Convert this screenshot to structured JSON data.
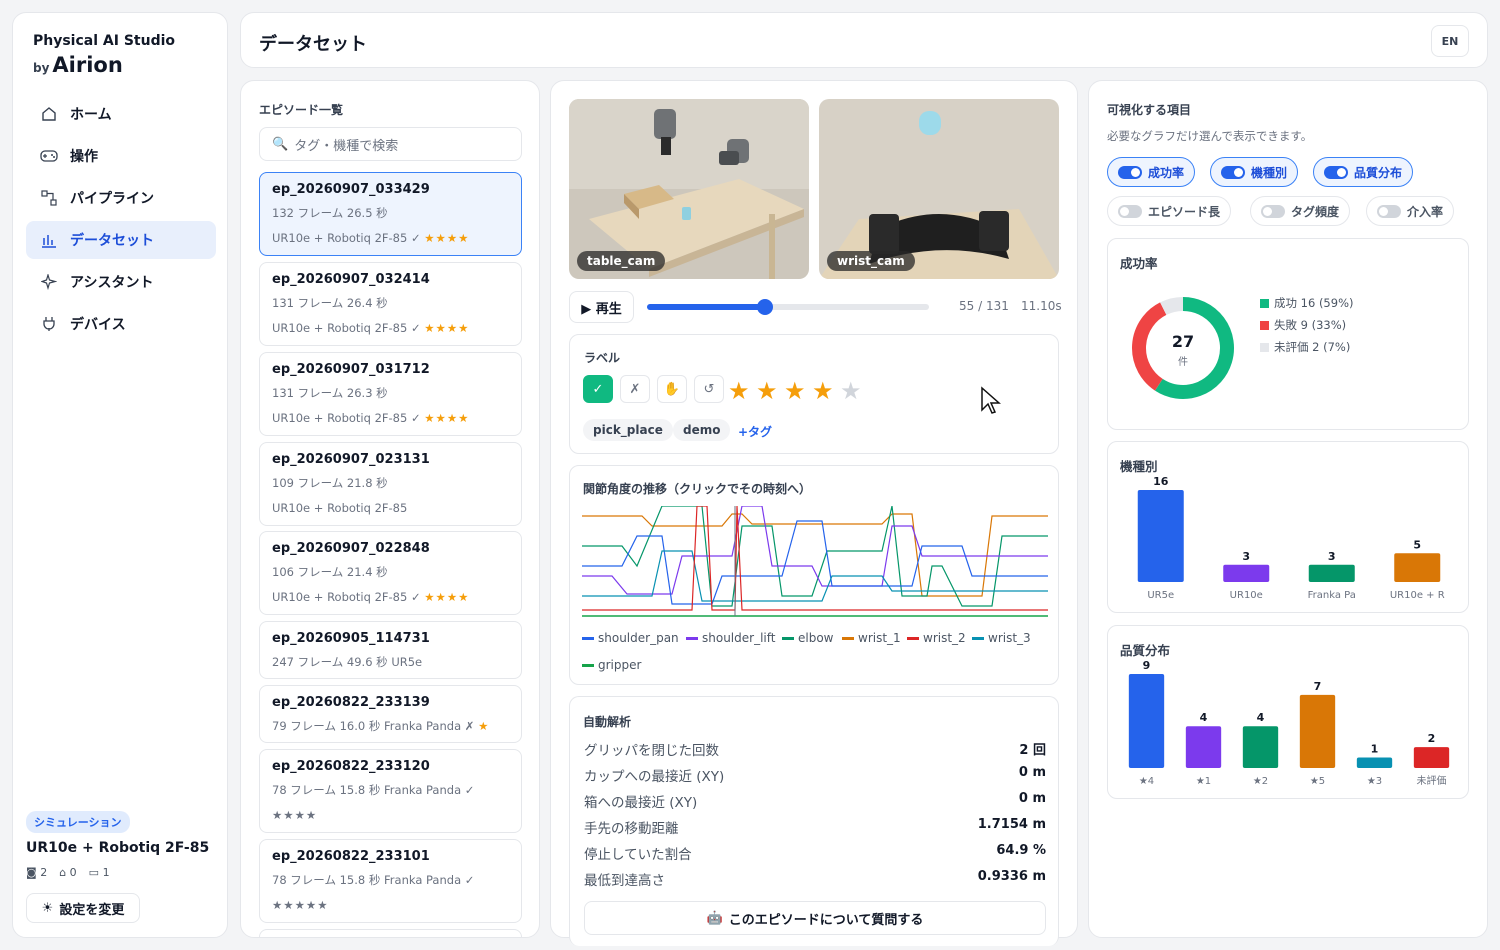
{
  "brand": {
    "line1": "Physical AI Studio",
    "by": "by",
    "name": "Airion"
  },
  "nav": [
    {
      "label": "ホーム",
      "icon": "home-icon"
    },
    {
      "label": "操作",
      "icon": "gamepad-icon"
    },
    {
      "label": "パイプライン",
      "icon": "pipeline-icon"
    },
    {
      "label": "データセット",
      "icon": "bar-chart-icon",
      "active": true
    },
    {
      "label": "アシスタント",
      "icon": "sparkle-icon"
    },
    {
      "label": "デバイス",
      "icon": "plug-icon"
    }
  ],
  "robot": {
    "badge": "シミュレーション",
    "name": "UR10e + Robotiq 2F-85",
    "cameras": "2",
    "arms": "0",
    "devices": "1",
    "settings_label": "設定を変更"
  },
  "header": {
    "title": "データセット",
    "lang": "EN"
  },
  "episodes": {
    "title": "エピソード一覧",
    "search_placeholder": "タグ・機種で検索",
    "items": [
      {
        "name": "ep_20260907_033429",
        "meta": "132 フレーム   26.5 秒",
        "robot": "UR10e + Robotiq 2F-85",
        "mark": "✓",
        "stars": "★★★★"
      },
      {
        "name": "ep_20260907_032414",
        "meta": "131 フレーム   26.4 秒",
        "robot": "UR10e + Robotiq 2F-85",
        "mark": "✓",
        "stars": "★★★★"
      },
      {
        "name": "ep_20260907_031712",
        "meta": "131 フレーム   26.3 秒",
        "robot": "UR10e + Robotiq 2F-85",
        "mark": "✓",
        "stars": "★★★★"
      },
      {
        "name": "ep_20260907_023131",
        "meta": "109 フレーム   21.8 秒",
        "robot": "UR10e + Robotiq 2F-85",
        "mark": "",
        "stars": ""
      },
      {
        "name": "ep_20260907_022848",
        "meta": "106 フレーム   21.4 秒",
        "robot": "UR10e + Robotiq 2F-85",
        "mark": "✓",
        "stars": "★★★★"
      },
      {
        "name": "ep_20260905_114731",
        "meta": "247 フレーム   49.6 秒   UR5e",
        "robot": "",
        "mark": "",
        "stars": ""
      },
      {
        "name": "ep_20260822_233139",
        "meta": "79 フレーム   16.0 秒   Franka Panda   ✗",
        "robot": "",
        "mark": "",
        "stars": "★"
      },
      {
        "name": "ep_20260822_233120",
        "meta": "78 フレーム   15.8 秒   Franka Panda   ✓",
        "robot": "",
        "mark": "",
        "stars": "★★★★"
      },
      {
        "name": "ep_20260822_233101",
        "meta": "78 フレーム   15.8 秒   Franka Panda   ✓",
        "robot": "",
        "mark": "",
        "stars": "★★★★★"
      }
    ]
  },
  "player": {
    "cam1": "table_cam",
    "cam2": "wrist_cam",
    "play_label": "▶ 再生",
    "frame": "55 / 131",
    "time": "11.10s",
    "progress": 0.42
  },
  "labels": {
    "title": "ラベル",
    "ok": "✓",
    "ng": "✗",
    "hand": "✋",
    "undo": "↺",
    "rating": 4,
    "tags": [
      "pick_place",
      "demo"
    ],
    "add_tag": "+タグ"
  },
  "joints": {
    "title": "関節角度の推移（クリックでその時刻へ）",
    "series": [
      {
        "name": "shoulder_pan",
        "color": "#2563eb"
      },
      {
        "name": "shoulder_lift",
        "color": "#7c3aed"
      },
      {
        "name": "elbow",
        "color": "#059669"
      },
      {
        "name": "wrist_1",
        "color": "#d97706"
      },
      {
        "name": "wrist_2",
        "color": "#dc2626"
      },
      {
        "name": "wrist_3",
        "color": "#0891b2"
      },
      {
        "name": "gripper",
        "color": "#16a34a"
      }
    ]
  },
  "analysis": {
    "title": "自動解析",
    "rows": [
      {
        "label": "グリッパを閉じた回数",
        "value": "2 回"
      },
      {
        "label": "カップへの最接近 (XY)",
        "value": "0 m"
      },
      {
        "label": "箱への最接近 (XY)",
        "value": "0 m"
      },
      {
        "label": "手先の移動距離",
        "value": "1.7154 m"
      },
      {
        "label": "停止していた割合",
        "value": "64.9 %"
      },
      {
        "label": "最低到達高さ",
        "value": "0.9336 m"
      }
    ],
    "ask_label": "このエピソードについて質問する"
  },
  "viz": {
    "title": "可視化する項目",
    "hint": "必要なグラフだけ選んで表示できます。",
    "toggles": [
      {
        "label": "成功率",
        "on": true
      },
      {
        "label": "機種別",
        "on": true
      },
      {
        "label": "品質分布",
        "on": true
      },
      {
        "label": "エピソード長",
        "on": false
      },
      {
        "label": "タグ頻度",
        "on": false
      },
      {
        "label": "介入率",
        "on": false
      }
    ]
  },
  "chart_data": [
    {
      "type": "pie",
      "title": "成功率",
      "center_value": "27",
      "center_unit": "件",
      "slices": [
        {
          "label": "成功 16 (59%)",
          "value": 16,
          "color": "#10b981"
        },
        {
          "label": "失敗 9 (33%)",
          "value": 9,
          "color": "#ef4444"
        },
        {
          "label": "未評価 2 (7%)",
          "value": 2,
          "color": "#e5e7eb"
        }
      ]
    },
    {
      "type": "bar",
      "title": "機種別",
      "categories": [
        "UR5e",
        "UR10e",
        "Franka Pa",
        "UR10e + R"
      ],
      "values": [
        16,
        3,
        3,
        5
      ],
      "colors": [
        "#2563eb",
        "#7c3aed",
        "#059669",
        "#d97706"
      ]
    },
    {
      "type": "bar",
      "title": "品質分布",
      "categories": [
        "★4",
        "★1",
        "★2",
        "★5",
        "★3",
        "未評価"
      ],
      "values": [
        9,
        4,
        4,
        7,
        1,
        2
      ],
      "colors": [
        "#2563eb",
        "#7c3aed",
        "#059669",
        "#d97706",
        "#0891b2",
        "#dc2626"
      ]
    }
  ]
}
